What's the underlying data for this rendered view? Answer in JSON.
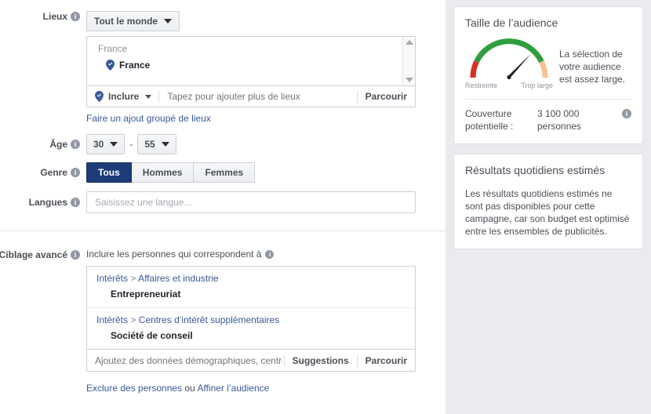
{
  "form": {
    "locations": {
      "label": "Lieux",
      "scope_button": "Tout le monde",
      "list_hint": "France",
      "selected": [
        {
          "name": "France",
          "icon": "map-pin-check-icon"
        }
      ],
      "include_button": "Inclure",
      "input_placeholder": "Tapez pour ajouter plus de lieux",
      "browse_button": "Parcourir",
      "bulk_link": "Faire un ajout groupé de lieux"
    },
    "age": {
      "label": "Âge",
      "min": "30",
      "max": "55",
      "separator": "-"
    },
    "gender": {
      "label": "Genre",
      "options": [
        "Tous",
        "Hommes",
        "Femmes"
      ],
      "selected": "Tous"
    },
    "languages": {
      "label": "Langues",
      "value": "",
      "placeholder": "Saisissez une langue..."
    },
    "advanced": {
      "label": "Ciblage avancé",
      "include_heading": "Inclure les personnes qui correspondent à",
      "groups": [
        {
          "category": "Intérêts",
          "separator": ">",
          "subcategory": "Affaires et industrie",
          "value": "Entrepreneuriat"
        },
        {
          "category": "Intérêts",
          "separator": ">",
          "subcategory": "Centres d’intérêt supplémentaires",
          "value": "Société de conseil"
        }
      ],
      "input_placeholder": "Ajoutez des données démographiques, centres d’int",
      "suggestions_button": "Suggestions",
      "browse_button": "Parcourir",
      "exclude_link": "Exclure des personnes",
      "or_text": "ou",
      "refine_link": "Affiner l’audience"
    }
  },
  "sidebar": {
    "audience_size": {
      "title": "Taille de l’audience",
      "gauge": {
        "left_label": "Restreinte",
        "right_label": "Trop large",
        "colors": {
          "narrow": "#d93025",
          "good": "#2e9e3e",
          "broad": "#f6c396",
          "needle": "#1d2129"
        },
        "needle_angle_deg": 48
      },
      "message": "La sélection de votre audience est assez large.",
      "reach_label": "Couverture potentielle :",
      "reach_value": "3 100 000",
      "reach_unit": "personnes"
    },
    "daily_results": {
      "title": "Résultats quotidiens estimés",
      "body": "Les résultats quotidiens estimés ne sont pas disponibles pour cette campagne, car son budget est optimisé entre les ensembles de publicités."
    }
  },
  "colors": {
    "brand_blue": "#3b5998",
    "active_navy": "#1d3c78",
    "panel_bg": "#e9ebee",
    "border": "#ccd0d5"
  }
}
